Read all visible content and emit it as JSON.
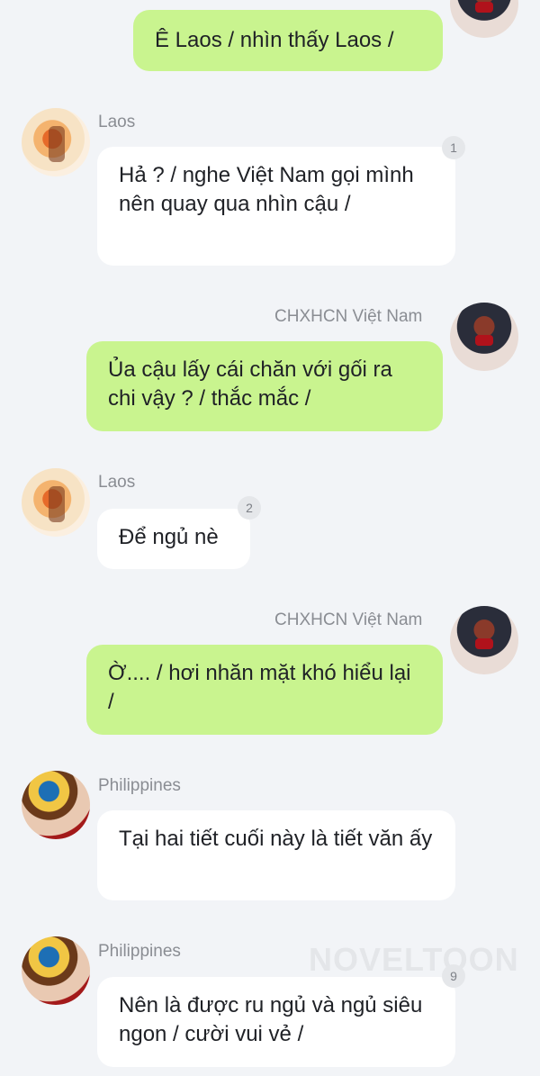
{
  "messages": [
    {
      "sender": "",
      "text": "Ê Laos / nhìn thấy Laos /"
    },
    {
      "sender": "Laos",
      "text": "Hả ? / nghe Việt Nam gọi mình nên quay qua nhìn cậu /",
      "badge": "1"
    },
    {
      "sender": "CHXHCN Việt Nam",
      "text": "Ủa cậu lấy cái chăn với gối ra chi vậy ? / thắc mắc /"
    },
    {
      "sender": "Laos",
      "text": "Để ngủ nè",
      "badge": "2"
    },
    {
      "sender": "CHXHCN Việt Nam",
      "text": "Ờ.... / hơi nhăn mặt khó hiểu lại /"
    },
    {
      "sender": "Philippines",
      "text": "Tại hai tiết cuối này là tiết văn ấy"
    },
    {
      "sender": "Philippines",
      "text": "Nên là được ru ngủ và ngủ siêu ngon / cười vui vẻ /",
      "badge": "9"
    }
  ],
  "watermark": "NOVELTOON",
  "colors": {
    "background": "#f2f4f7",
    "outgoing": "#c9f48f",
    "incoming": "#ffffff"
  }
}
